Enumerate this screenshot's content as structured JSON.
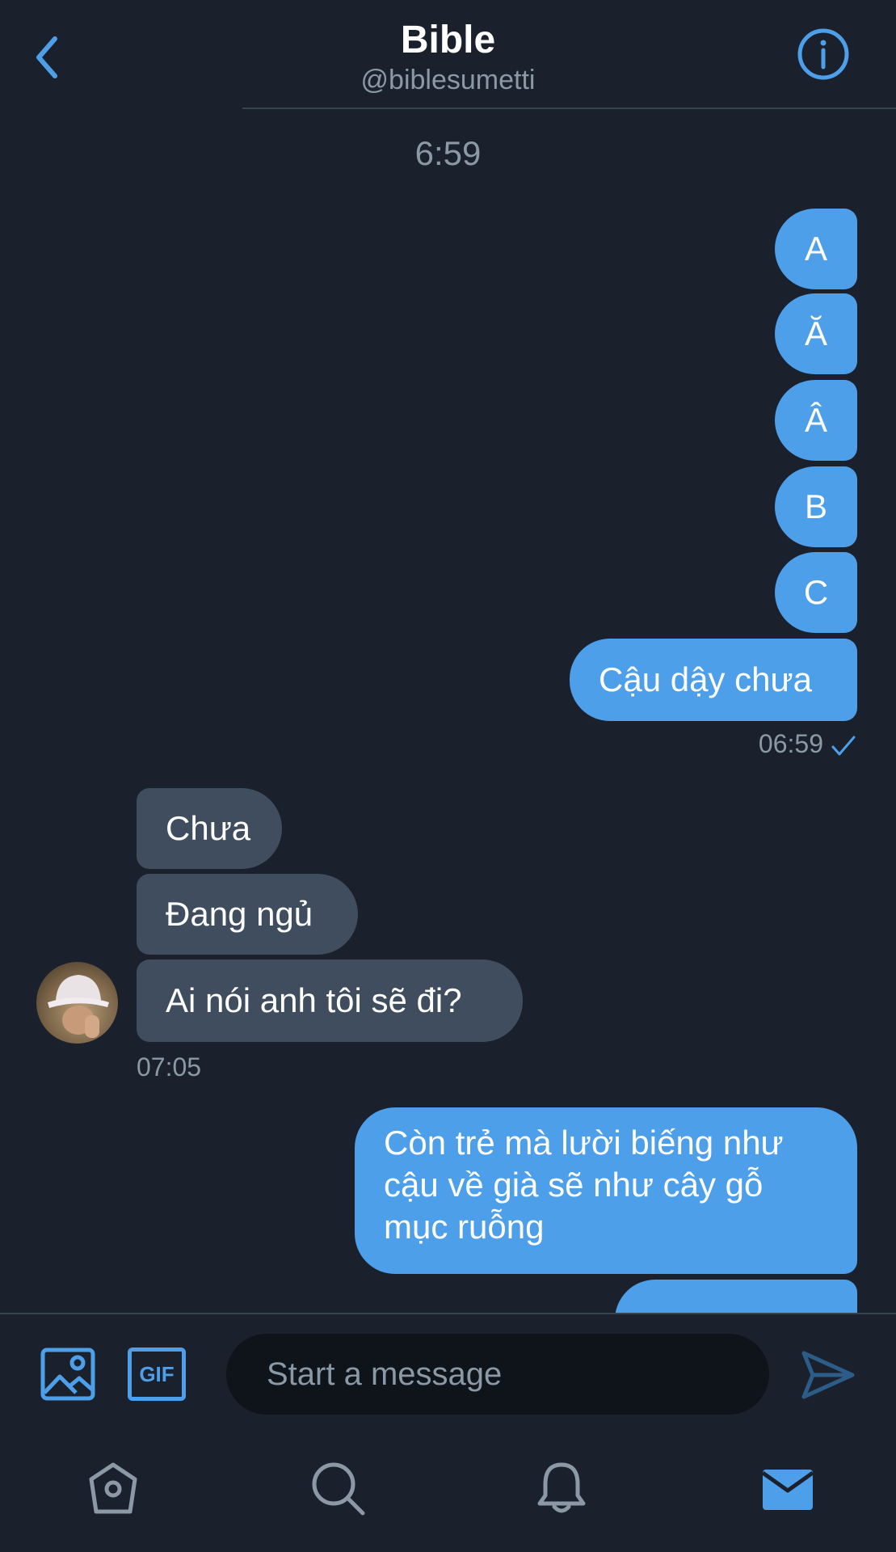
{
  "header": {
    "title": "Bible",
    "handle": "@biblesumetti",
    "back_icon": "chevron-left-icon",
    "info_icon": "info-icon"
  },
  "conversation": {
    "day_time": "6:59",
    "outgoing_group_1": {
      "messages": [
        "A",
        "Ă",
        "Â",
        "B",
        "C",
        "Cậu dậy chưa"
      ],
      "timestamp": "06:59"
    },
    "incoming_group": {
      "messages": [
        "Chưa",
        "Đang ngủ",
        "Ai nói anh tôi sẽ đi?"
      ],
      "timestamp": "07:05"
    },
    "outgoing_group_2": {
      "message_line_1": "Còn trẻ mà lười biếng như",
      "message_line_2": "cậu về già sẽ như cây gỗ",
      "message_line_3": "mục ruỗng"
    }
  },
  "composer": {
    "placeholder": "Start a message",
    "image_icon": "image-icon",
    "gif_label": "GIF",
    "send_icon": "send-icon"
  },
  "tabbar": {
    "items": [
      "home-icon",
      "search-icon",
      "bell-icon",
      "mail-icon"
    ]
  },
  "colors": {
    "background": "#1a212c",
    "accent": "#4d9fe9",
    "incoming_bubble": "#3f4d5e",
    "muted_text": "#8b98a5"
  }
}
